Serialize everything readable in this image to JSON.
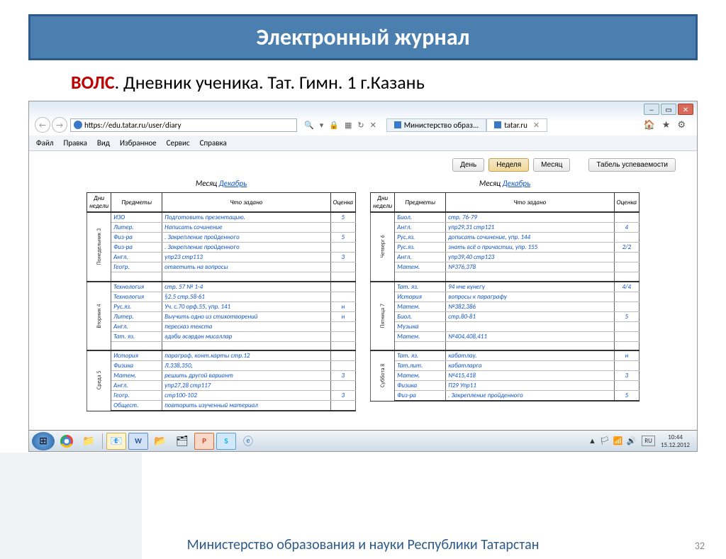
{
  "slide": {
    "title": "Электронный журнал",
    "subtitle_red": "ВОЛС",
    "subtitle_rest": ".  Дневник ученика. Тат. Гимн. 1  г.Казань",
    "footer": "Министерство образования и науки Республики Татарстан",
    "page_num": "32"
  },
  "browser": {
    "url": "https://edu.tatar.ru/user/diary",
    "tabs": [
      {
        "label": "Министерство образ...",
        "active": false
      },
      {
        "label": "tatar.ru",
        "active": true
      }
    ],
    "menu": [
      "Файл",
      "Правка",
      "Вид",
      "Избранное",
      "Сервис",
      "Справка"
    ]
  },
  "view_controls": {
    "day": "День",
    "week": "Неделя",
    "month": "Месяц",
    "report": "Табель успеваемости"
  },
  "diary": {
    "month_label": "Месяц",
    "month_value": "Декабрь",
    "headers": {
      "day": "Дни недели",
      "subject": "Предметы",
      "task": "Что задано",
      "grade": "Оценка"
    },
    "left": [
      {
        "day": "Понедельник 3",
        "rows": [
          {
            "s": "ИЗО",
            "t": "Подготовить презентацию.",
            "g": "5"
          },
          {
            "s": "Литер.",
            "t": "Написать сочинение",
            "g": ""
          },
          {
            "s": "Физ-ра",
            "t": ". Закрепление пройденного",
            "g": "5"
          },
          {
            "s": "Физ-ра",
            "t": ". Закрепление пройденного",
            "g": ""
          },
          {
            "s": "Англ.",
            "t": "упр23 стр113",
            "g": "3"
          },
          {
            "s": "Геогр.",
            "t": "ответить на вопросы",
            "g": ""
          },
          {
            "s": "",
            "t": "",
            "g": ""
          }
        ]
      },
      {
        "day": "Вторник 4",
        "rows": [
          {
            "s": "Технология",
            "t": "стр. 57 № 1-4",
            "g": ""
          },
          {
            "s": "Технология",
            "t": "§2.5 стр.58-61",
            "g": ""
          },
          {
            "s": "Рус.яз.",
            "t": "Уч. с.70 орф.55, упр. 141",
            "g": "н"
          },
          {
            "s": "Литер.",
            "t": "Выучить одно из стихотворений",
            "g": "н"
          },
          {
            "s": "Англ.",
            "t": "пересказ текста",
            "g": ""
          },
          {
            "s": "Тат. яз.",
            "t": "әдәби әсәрдән мисаллар",
            "g": ""
          },
          {
            "s": "",
            "t": "",
            "g": ""
          }
        ]
      },
      {
        "day": "Среда 5",
        "rows": [
          {
            "s": "История",
            "t": "параграф, конт.карты стр.12",
            "g": ""
          },
          {
            "s": "Физика",
            "t": "Л.338,350,",
            "g": ""
          },
          {
            "s": "Матем.",
            "t": "решить другой вариант",
            "g": "3"
          },
          {
            "s": "Англ.",
            "t": "упр27,28 стр117",
            "g": ""
          },
          {
            "s": "Геогр.",
            "t": "стр100-102",
            "g": "3"
          },
          {
            "s": "Общест.",
            "t": "повторить изученный материал",
            "g": ""
          }
        ]
      }
    ],
    "right": [
      {
        "day": "Четверг 6",
        "rows": [
          {
            "s": "Биол.",
            "t": "стр. 76-79",
            "g": ""
          },
          {
            "s": "Англ.",
            "t": "упр29,31 стр121",
            "g": "4"
          },
          {
            "s": "Рус.яз.",
            "t": "дописать сочинение, упр. 144",
            "g": ""
          },
          {
            "s": "Рус.яз.",
            "t": "знать всё о причастии, упр. 155",
            "g": "2/2"
          },
          {
            "s": "Англ.",
            "t": "упр39,40 стр123",
            "g": ""
          },
          {
            "s": "Матем.",
            "t": "№376,378",
            "g": ""
          },
          {
            "s": "",
            "t": "",
            "g": ""
          }
        ]
      },
      {
        "day": "Пятница 7",
        "rows": [
          {
            "s": "Тат. яз.",
            "t": "94 нче күнегү",
            "g": "4/4"
          },
          {
            "s": "История",
            "t": "вопросы к параграфу",
            "g": ""
          },
          {
            "s": "Матем.",
            "t": "№382,386",
            "g": ""
          },
          {
            "s": "Биол.",
            "t": "стр.80-81",
            "g": "5"
          },
          {
            "s": "Музыка",
            "t": "",
            "g": ""
          },
          {
            "s": "Матем.",
            "t": "№404,408,411",
            "g": ""
          },
          {
            "s": "",
            "t": "",
            "g": ""
          }
        ]
      },
      {
        "day": "Суббота 8",
        "rows": [
          {
            "s": "Тат. яз.",
            "t": "кабатлау.",
            "g": "н"
          },
          {
            "s": "Тат.лит.",
            "t": "кабатларга",
            "g": ""
          },
          {
            "s": "Матем.",
            "t": "№415,418",
            "g": "3"
          },
          {
            "s": "Физика",
            "t": "П29 Упр11",
            "g": ""
          },
          {
            "s": "Физ-ра",
            "t": ". Закрепление пройденного",
            "g": "5"
          }
        ]
      }
    ]
  },
  "taskbar": {
    "lang": "RU",
    "time": "10:44",
    "date": "15.12.2012"
  }
}
